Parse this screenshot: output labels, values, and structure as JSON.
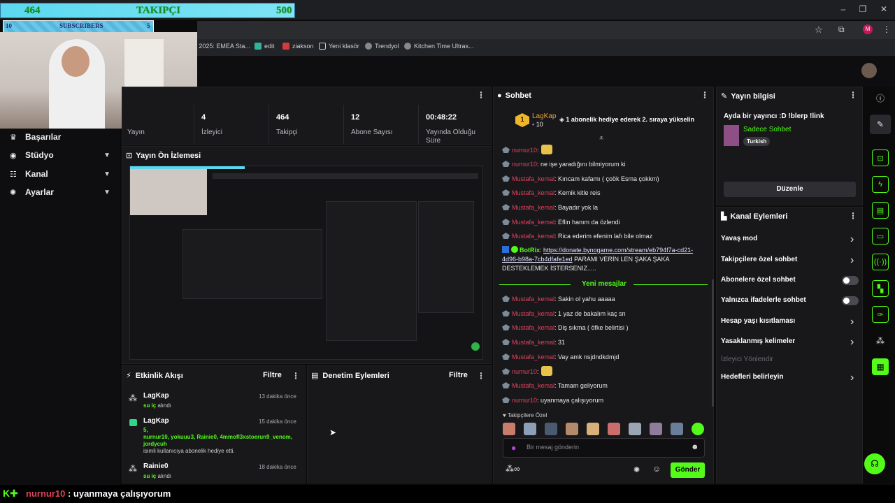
{
  "overlay": {
    "followers_current": "464",
    "followers_label": "TAKIPÇI",
    "followers_goal": "500",
    "subs_current": "10",
    "subs_label": "SUBSCRIBERS",
    "subs_goal": "5"
  },
  "bookmarks": [
    "CT 2025: EMEA Sta...",
    "edit",
    "ziakson",
    "Yeni klasör",
    "Trendyol",
    "Kitchen Time Ultras..."
  ],
  "sidebar": {
    "items": [
      {
        "label": "Başarılar",
        "icon": "trophy-icon"
      },
      {
        "label": "Stüdyo",
        "icon": "studio-icon"
      },
      {
        "label": "Kanal",
        "icon": "channel-icon"
      },
      {
        "label": "Ayarlar",
        "icon": "gear-icon"
      }
    ]
  },
  "stats": [
    {
      "value": "",
      "label": "Yayın"
    },
    {
      "value": "4",
      "label": "İzleyici"
    },
    {
      "value": "464",
      "label": "Takipçi"
    },
    {
      "value": "12",
      "label": "Abone Sayısı"
    },
    {
      "value": "00:48:22",
      "label": "Yayında Olduğu Süre"
    }
  ],
  "preview": {
    "title": "Yayın Ön İzlemesi"
  },
  "activity": {
    "title": "Etkinlik Akışı",
    "filter": "Filtre",
    "events": [
      {
        "name": "LagKap",
        "line1": "su iç",
        "line1_suffix": " alındı",
        "time": "13 dakika önce"
      },
      {
        "name": "LagKap",
        "line1": "5,",
        "line2": "nurnur10, yokuuu3, Rainie0, 4mmofl3xstoerun9_venom, jordycuh",
        "line3": "isimli kullanıcıya abonelik hediye etti.",
        "time": "15 dakika önce"
      },
      {
        "name": "Rainie0",
        "line1": "su iç",
        "line1_suffix": " alındı",
        "time": "18 dakika önce"
      }
    ]
  },
  "moderation": {
    "title": "Denetim Eylemleri",
    "filter": "Filtre"
  },
  "chat": {
    "title": "Sohbet",
    "pinned_user": "LagKap",
    "pinned_rank": "1",
    "pinned_count": "10",
    "pinned_text": "1 abonelik hediye ederek 2. sıraya yükselin",
    "messages": [
      {
        "user": "nurnur10",
        "text": ":"
      },
      {
        "user": "nurnur10",
        "text": ": ne işe yaradığını bilmiyorum ki"
      },
      {
        "user": "Mustafa_kemal",
        "text": ": Kırıcam kafamı ( çoök Esma çokkm)"
      },
      {
        "user": "Mustafa_kemal",
        "text": ": Kemik kitle reis"
      },
      {
        "user": "Mustafa_kemal",
        "text": ": Bayadır yok la"
      },
      {
        "user": "Mustafa_kemal",
        "text": ": Eflin hanım da özlendi"
      },
      {
        "user": "Mustafa_kemal",
        "text": ": Rica ederim efenim lafı bile olmaz"
      }
    ],
    "bot_user": "BotRix",
    "bot_link_1": "https://donate.bynogame.com/stream/eb794f7a-cd21-",
    "bot_link_2": "4d96-b98a-7cb4dfafe1ed",
    "bot_text_1": " PARAMI VERİN LEN ŞAKA ŞAKA",
    "bot_text_2": "DESTEKLEMEK İSTERSENIZ.....",
    "new_messages": "Yeni mesajlar",
    "messages2": [
      {
        "user": "Mustafa_kemal",
        "text": ": Sakin ol yahu aaaaa"
      },
      {
        "user": "Mustafa_kemal",
        "text": ": 1 yaz de bakalım kaç sn"
      },
      {
        "user": "Mustafa_kemal",
        "text": ": Diş sıkma ( öfke belirtisi )"
      },
      {
        "user": "Mustafa_kemal",
        "text": ": 31"
      },
      {
        "user": "Mustafa_kemal",
        "text": ": Vay amk nsjdndkdmjd"
      },
      {
        "user": "nurnur10",
        "text": ":"
      },
      {
        "user": "Mustafa_kemal",
        "text": ": Tamam geliyorum"
      },
      {
        "user": "nurnur10",
        "text": ": uyanmaya çalışıyorum"
      }
    ],
    "emote_label": "Takipçilere Özel",
    "input_placeholder": "Bir mesaj gönderin",
    "send": "Gönder"
  },
  "stream_info": {
    "title": "Yayın bilgisi",
    "stream_title": "Ayda bir yayıncı :D !blerp !link",
    "category": "Sadece Sohbet",
    "language": "Turkish",
    "edit": "Düzenle"
  },
  "channel_actions": {
    "title": "Kanal Eylemleri",
    "items": [
      {
        "label": "Yavaş mod",
        "kind": "chevron"
      },
      {
        "label": "Takipçilere özel sohbet",
        "kind": "chevron"
      },
      {
        "label": "Abonelere özel sohbet",
        "kind": "toggle"
      },
      {
        "label": "Yalnızca ifadelerle sohbet",
        "kind": "toggle"
      },
      {
        "label": "Hesap yaşı kısıtlaması",
        "kind": "chevron"
      },
      {
        "label": "Yasaklanmış kelimeler",
        "kind": "chevron"
      },
      {
        "label": "İzleyici Yönlendir",
        "kind": "disabled"
      },
      {
        "label": "Hedefleri belirleyin",
        "kind": "chevron"
      }
    ]
  },
  "bottom_overlay": {
    "user": "nurnur10",
    "text": " : uyanmaya çalışıyorum"
  },
  "colors": {
    "accent": "#53fc18",
    "username_red": "#e0415a",
    "panel": "#18181b",
    "background": "#0b0b0c"
  }
}
